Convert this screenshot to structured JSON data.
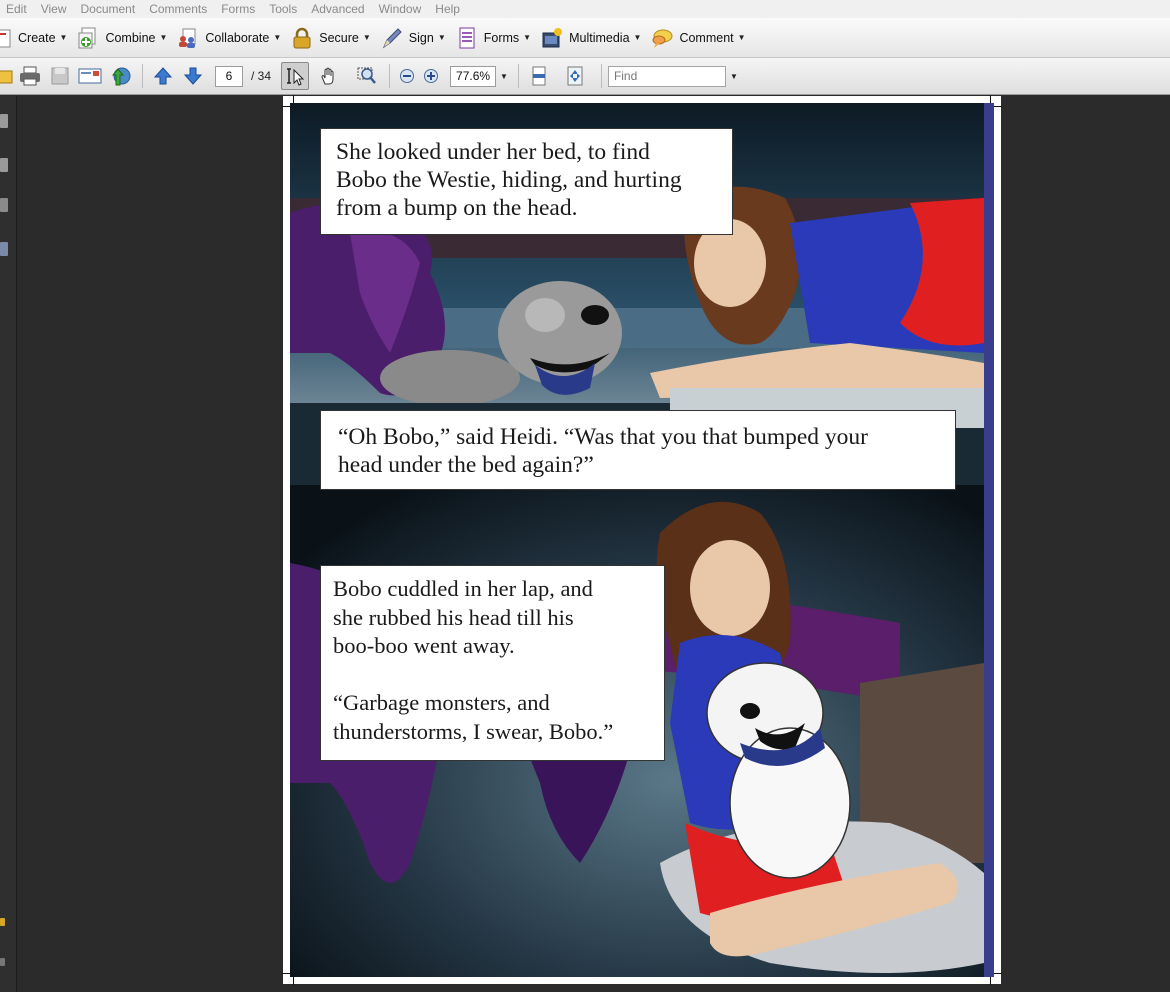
{
  "menubar": {
    "items": [
      "Edit",
      "View",
      "Document",
      "Comments",
      "Forms",
      "Tools",
      "Advanced",
      "Window",
      "Help"
    ]
  },
  "task_toolbar": {
    "items": [
      {
        "label": "Create",
        "icon": "create-icon"
      },
      {
        "label": "Combine",
        "icon": "combine-icon"
      },
      {
        "label": "Collaborate",
        "icon": "collaborate-icon"
      },
      {
        "label": "Secure",
        "icon": "lock-icon"
      },
      {
        "label": "Sign",
        "icon": "pen-icon"
      },
      {
        "label": "Forms",
        "icon": "form-icon"
      },
      {
        "label": "Multimedia",
        "icon": "film-icon"
      },
      {
        "label": "Comment",
        "icon": "speech-bubble-icon"
      }
    ]
  },
  "nav_toolbar": {
    "current_page": "6",
    "total_pages": "/ 34",
    "zoom": "77.6%",
    "find_placeholder": "Find"
  },
  "document": {
    "caption_1": "She looked under her bed, to find\nBobo the Westie, hiding, and hurting\nfrom a bump on the head.",
    "caption_2": "“Oh Bobo,” said Heidi.  “Was that you that bumped your\nhead under the bed again?”",
    "caption_3": "Bobo cuddled in her lap, and\nshe rubbed his head till his\nboo-boo went away.\n\n“Garbage monsters, and\nthunderstorms, I swear, Bobo.”"
  },
  "colors": {
    "page_background": "#2b2b2b",
    "toolbar_background": "#e6e6e6",
    "panel_border_blue": "#3a3d8c"
  }
}
